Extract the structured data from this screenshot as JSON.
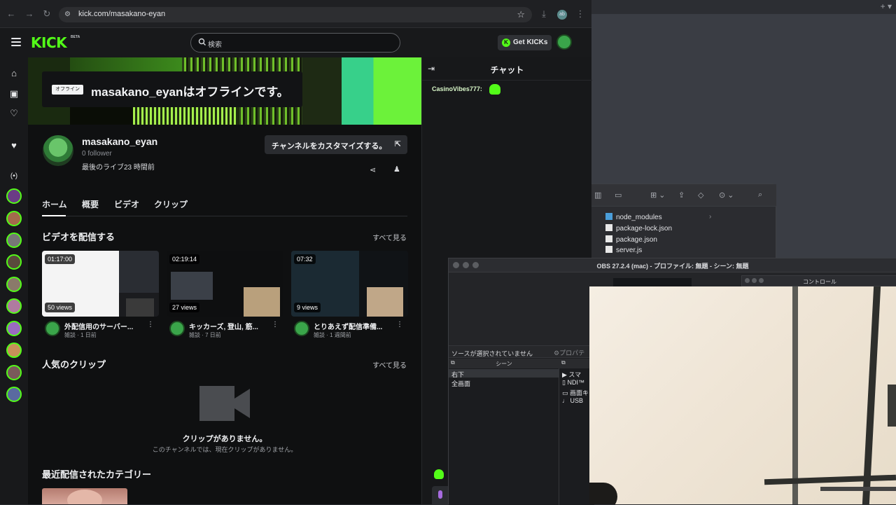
{
  "browser": {
    "url": "kick.com/masakano-eyan",
    "avatar_initials": "ab"
  },
  "kick": {
    "logo": "KICK",
    "beta": "BETA",
    "search_placeholder": "検索",
    "get_kicks": "Get KICKs",
    "brand_color": "#53fc18"
  },
  "banner": {
    "offline_tag": "オフライン",
    "offline_text": "masakano_eyanはオフラインです。"
  },
  "channel": {
    "name": "masakano_eyan",
    "followers": "0 follower",
    "last_live": "最後のライブ23 時間前",
    "customize": "チャンネルをカスタマイズする。"
  },
  "tabs": [
    "ホーム",
    "概要",
    "ビデオ",
    "クリップ"
  ],
  "videos_section": {
    "title": "ビデオを配信する",
    "see_all": "すべて見る",
    "items": [
      {
        "duration": "01:17:00",
        "views": "50 views",
        "title": "外配信用のサーバー...",
        "meta": "雑談 · 1 日前"
      },
      {
        "duration": "02:19:14",
        "views": "27 views",
        "title": "キッカーズ, 登山, 筋...",
        "meta": "雑談 · 7 日前"
      },
      {
        "duration": "07:32",
        "views": "9 views",
        "title": "とりあえず配信準備...",
        "meta": "雑談 · 1 週間前"
      }
    ]
  },
  "clips_section": {
    "title": "人気のクリップ",
    "see_all": "すべて見る",
    "empty_title": "クリップがありません。",
    "empty_sub": "このチャンネルでは、現在クリップがありません。"
  },
  "categories_section": {
    "title": "最近配信されたカテゴリー"
  },
  "chat": {
    "title": "チャット",
    "user": "CasinoVibes777:"
  },
  "finder": {
    "items": [
      "node_modules",
      "package-lock.json",
      "package.json",
      "server.js"
    ]
  },
  "obs": {
    "title": "OBS 27.2.4 (mac) - プロファイル: 無題 - シーン: 無題",
    "controls": "コントロール",
    "no_source": "ソースが選択されていません",
    "properties": "プロパテ",
    "scenes_header": "シーン",
    "scenes": [
      "右下",
      "全画面"
    ],
    "sources": [
      "スマ",
      "NDI™",
      "画面キ",
      "USB"
    ]
  }
}
